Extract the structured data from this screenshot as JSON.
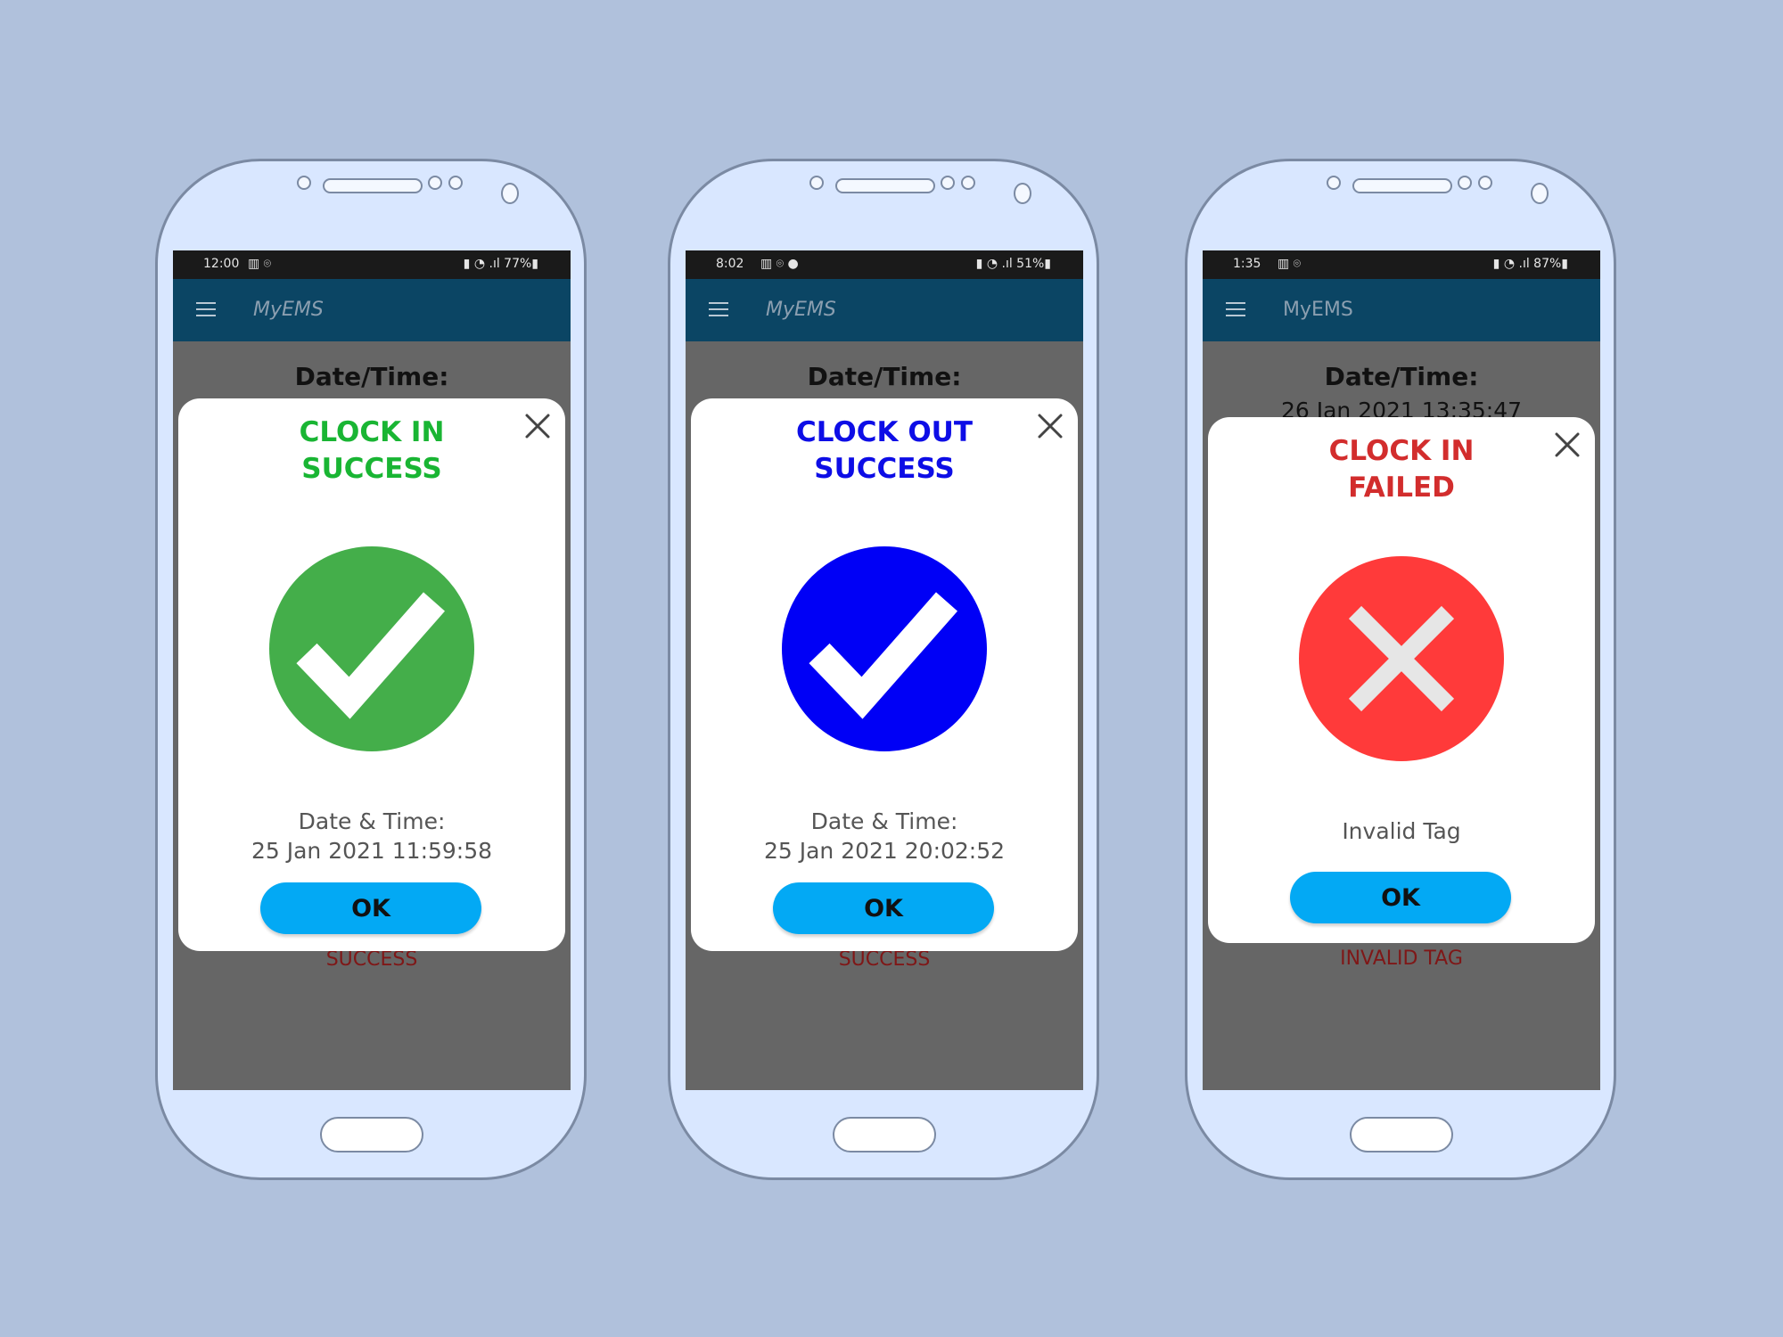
{
  "colors": {
    "background": "#b0c1dc",
    "phone_body": "#d9e7ff",
    "app_bar": "#0b4564",
    "ok_button": "#03a9f4",
    "success_green": "#19b533",
    "clockout_blue": "#0d0de6",
    "failed_red": "#d22d2d",
    "icon_green": "#44ae4a",
    "icon_blue": "#0000f6",
    "icon_red": "#ff3a3a"
  },
  "phones": [
    {
      "status_bar": {
        "time": "12:00",
        "left_icons": "▥ ⌾",
        "right_icons": "▮ ◔ .ıl 77%▮"
      },
      "app_bar": {
        "menu_icon": "hamburger-menu-icon",
        "title": "MyEMS"
      },
      "background": {
        "label": "Date/Time:",
        "value": "",
        "result": "SUCCESS"
      },
      "dialog": {
        "title_line1": "CLOCK IN",
        "title_line2": "SUCCESS",
        "icon": "check-circle-icon",
        "detail_label": "Date & Time:",
        "detail_value": "25 Jan 2021 11:59:58",
        "button": "OK"
      }
    },
    {
      "status_bar": {
        "time": "8:02",
        "left_icons": "▥ ⌾ ●",
        "right_icons": "▮ ◔ .ıl 51%▮"
      },
      "app_bar": {
        "menu_icon": "hamburger-menu-icon",
        "title": "MyEMS"
      },
      "background": {
        "label": "Date/Time:",
        "value": "",
        "result": "SUCCESS"
      },
      "dialog": {
        "title_line1": "CLOCK OUT",
        "title_line2": "SUCCESS",
        "icon": "check-circle-icon",
        "detail_label": "Date & Time:",
        "detail_value": "25 Jan 2021 20:02:52",
        "button": "OK"
      }
    },
    {
      "status_bar": {
        "time": "1:35",
        "left_icons": "▥ ⌾",
        "right_icons": "▮ ◔ .ıl 87%▮"
      },
      "app_bar": {
        "menu_icon": "hamburger-menu-icon",
        "title": "MyEMS"
      },
      "background": {
        "label": "Date/Time:",
        "value": "26 Jan 2021 13:35:47",
        "result": "INVALID TAG"
      },
      "dialog": {
        "title_line1": "CLOCK IN",
        "title_line2": "FAILED",
        "icon": "x-circle-icon",
        "message": "Invalid Tag",
        "button": "OK"
      }
    }
  ]
}
